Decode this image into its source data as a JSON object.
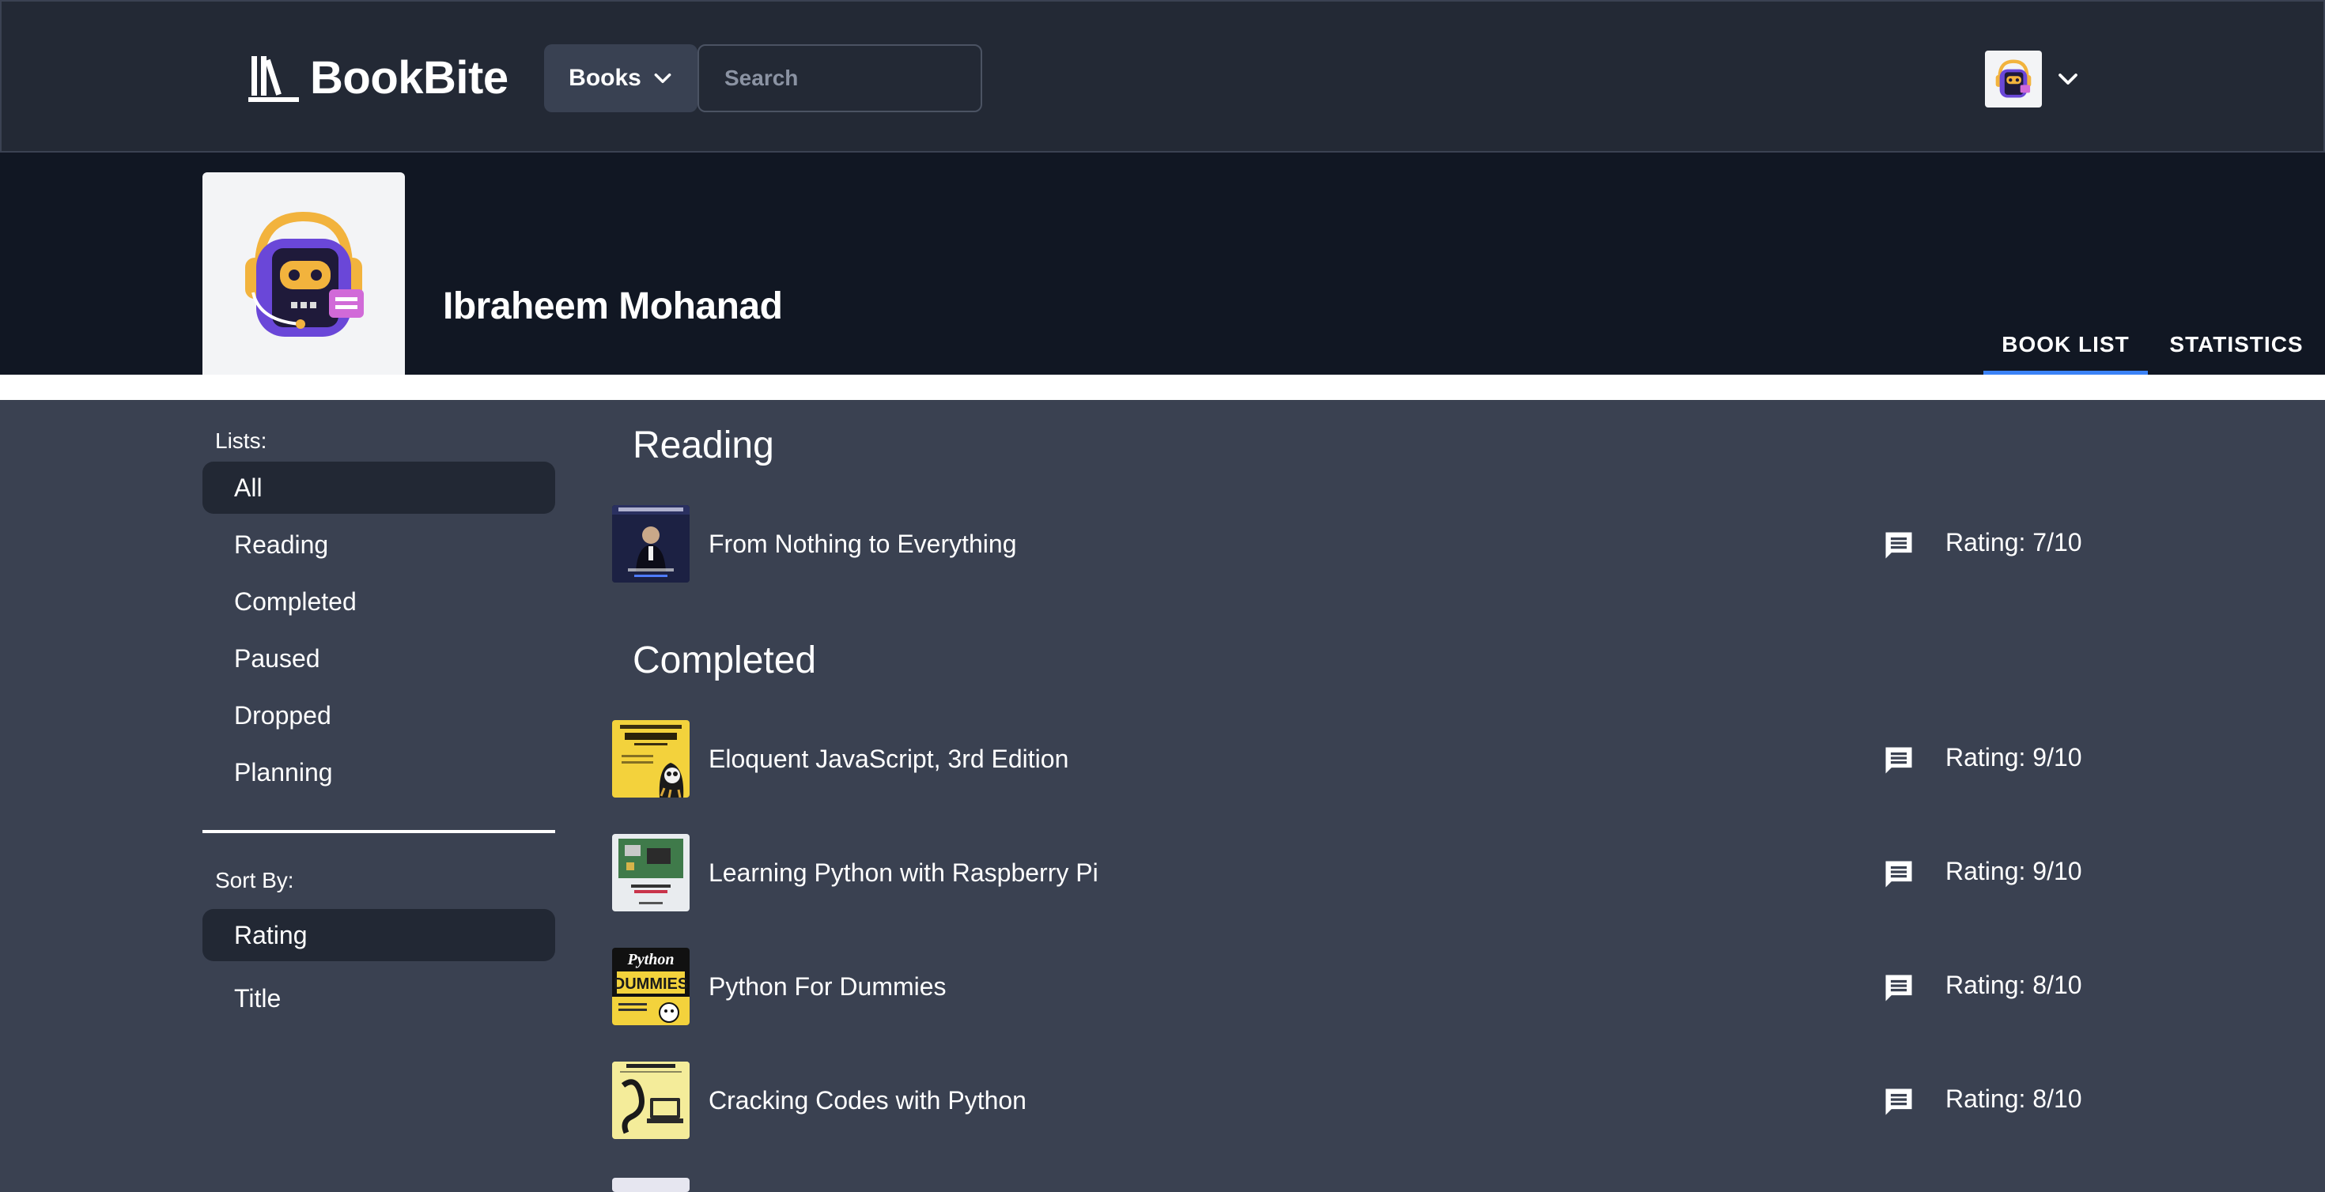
{
  "navbar": {
    "brand": "BookBite",
    "books_button": "Books",
    "search_placeholder": "Search"
  },
  "profile": {
    "name": "Ibraheem Mohanad",
    "tabs": [
      "BOOK LIST",
      "STATISTICS"
    ],
    "active_tab": "BOOK LIST"
  },
  "sidebar": {
    "lists_label": "Lists:",
    "lists": [
      "All",
      "Reading",
      "Completed",
      "Paused",
      "Dropped",
      "Planning"
    ],
    "active_list": "All",
    "sort_label": "Sort By:",
    "sort_options": [
      "Rating",
      "Title"
    ],
    "active_sort": "Rating"
  },
  "groups": [
    {
      "title": "Reading",
      "books": [
        {
          "title": "From Nothing to Everything",
          "rating": "Rating: 7/10"
        }
      ]
    },
    {
      "title": "Completed",
      "books": [
        {
          "title": "Eloquent JavaScript, 3rd Edition",
          "rating": "Rating: 9/10"
        },
        {
          "title": "Learning Python with Raspberry Pi",
          "rating": "Rating: 9/10"
        },
        {
          "title": "Python For Dummies",
          "rating": "Rating: 8/10"
        },
        {
          "title": "Cracking Codes with Python",
          "rating": "Rating: 8/10"
        }
      ]
    }
  ],
  "icons": {
    "logo": "books-logo-icon",
    "dropdown": "chevron-down-icon",
    "comment": "comment-icon"
  },
  "colors": {
    "navbar_bg": "#232935",
    "profile_bg": "#111723",
    "content_bg": "#3a4151",
    "active_item_bg": "#222834",
    "accent": "#3b82f6"
  }
}
